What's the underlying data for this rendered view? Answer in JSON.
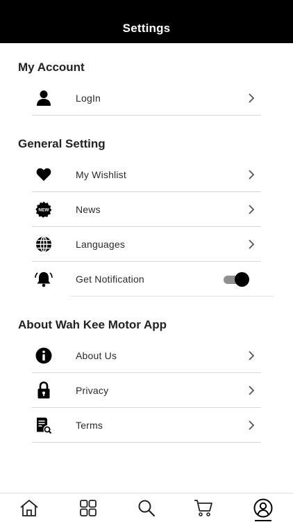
{
  "header": {
    "title": "Settings"
  },
  "sections": {
    "account": {
      "title": "My Account",
      "items": [
        {
          "label": "LogIn",
          "icon": "user-icon"
        }
      ]
    },
    "general": {
      "title": "General Setting",
      "items": [
        {
          "label": "My Wishlist",
          "icon": "heart-icon"
        },
        {
          "label": "News",
          "icon": "news-badge-icon",
          "badge_text": "NEW"
        },
        {
          "label": "Languages",
          "icon": "globe-icon"
        },
        {
          "label": "Get Notification",
          "icon": "bell-icon",
          "toggle_on": true
        }
      ]
    },
    "about": {
      "title": "About Wah Kee Motor App",
      "items": [
        {
          "label": "About Us",
          "icon": "info-icon"
        },
        {
          "label": "Privacy",
          "icon": "lock-icon"
        },
        {
          "label": "Terms",
          "icon": "document-search-icon"
        }
      ]
    }
  },
  "tabbar": {
    "tabs": [
      "home-icon",
      "categories-icon",
      "search-icon",
      "cart-icon",
      "profile-icon"
    ],
    "active": "profile-icon"
  },
  "colors": {
    "header_bg": "#000000",
    "toggle_knob": "#000000",
    "toggle_track": "#8f8f8f"
  }
}
